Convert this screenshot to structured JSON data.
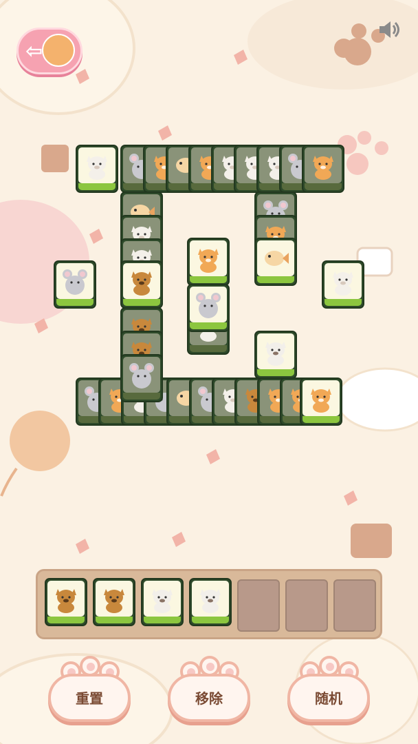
{
  "header": {
    "back_icon": "back-arrow-icon",
    "sound_icon": "speaker-icon"
  },
  "board": {
    "tiles": [
      {
        "animal": "cat-white",
        "active": true
      },
      {
        "animal": "mouse",
        "active": false
      },
      {
        "animal": "cat-orange",
        "active": false
      },
      {
        "animal": "fish",
        "active": false
      },
      {
        "animal": "cat-orange",
        "active": false
      },
      {
        "animal": "cat-white",
        "active": false
      },
      {
        "animal": "cat-white",
        "active": false
      },
      {
        "animal": "cat-white",
        "active": false
      },
      {
        "animal": "mouse",
        "active": false
      },
      {
        "animal": "cat-orange",
        "active": false
      },
      {
        "animal": "fish",
        "active": false
      },
      {
        "animal": "cat-white",
        "active": false
      },
      {
        "animal": "cat-white",
        "active": false
      },
      {
        "animal": "mouse",
        "active": false
      },
      {
        "animal": "cat-orange",
        "active": false
      },
      {
        "animal": "mouse",
        "active": true
      },
      {
        "animal": "cat-tabby",
        "active": true
      },
      {
        "animal": "cat-orange",
        "active": true
      },
      {
        "animal": "fish",
        "active": true
      },
      {
        "animal": "cat-white",
        "active": true
      },
      {
        "animal": "mouse",
        "active": true
      },
      {
        "animal": "cat-ragdoll",
        "active": true
      },
      {
        "animal": "cat-orange",
        "active": true
      },
      {
        "animal": "mouse",
        "active": false
      },
      {
        "animal": "cat-orange",
        "active": false
      },
      {
        "animal": "cat-white",
        "active": false
      },
      {
        "animal": "mouse",
        "active": false
      },
      {
        "animal": "fish",
        "active": false
      },
      {
        "animal": "mouse",
        "active": false
      },
      {
        "animal": "cat-white",
        "active": false
      },
      {
        "animal": "cat-tabby",
        "active": false
      },
      {
        "animal": "cat-orange",
        "active": false
      },
      {
        "animal": "cat-orange",
        "active": false
      },
      {
        "animal": "cat-white",
        "active": false
      },
      {
        "animal": "cat-tabby",
        "active": false
      },
      {
        "animal": "cat-tabby",
        "active": false
      },
      {
        "animal": "mouse",
        "active": false
      }
    ]
  },
  "tray": {
    "slots": [
      "cat-tabby",
      "cat-tabby",
      "cat-ragdoll",
      "cat-ragdoll",
      "",
      "",
      ""
    ]
  },
  "actions": {
    "reset_label": "重置",
    "remove_label": "移除",
    "shuffle_label": "随机"
  },
  "colors": {
    "background": "#fbf1e3",
    "tile_base": "#8cc63f",
    "tile_face": "#fbf7e1",
    "tray": "#d9b99a",
    "button_text": "#7a4a33"
  }
}
